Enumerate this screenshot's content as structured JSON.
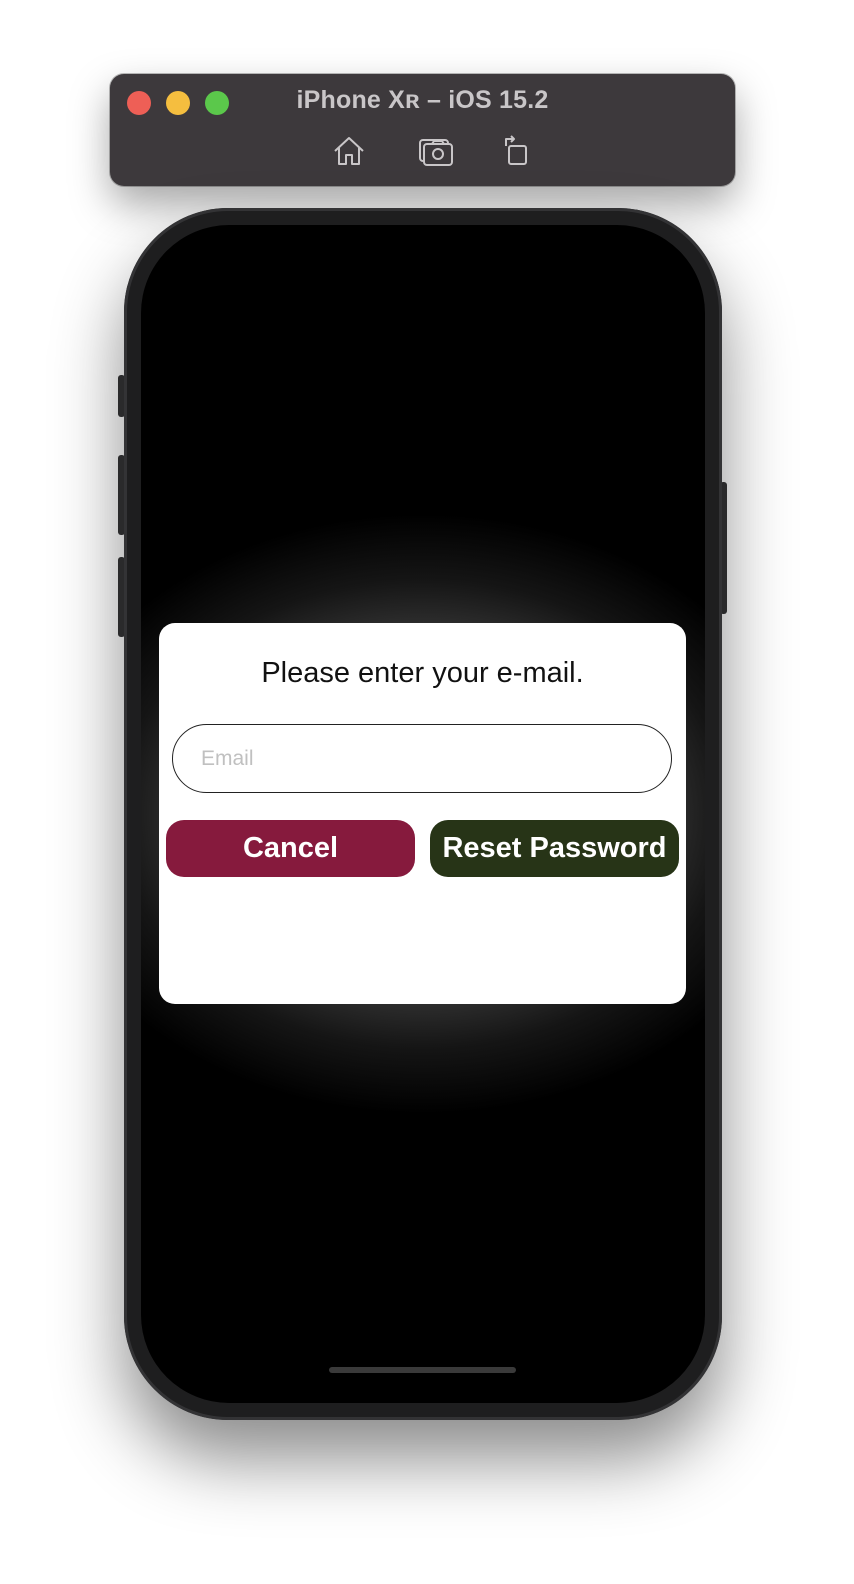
{
  "window": {
    "title": "iPhone Xʀ – iOS 15.2"
  },
  "toolbar": {
    "icons": [
      "home-icon",
      "screenshot-icon",
      "rotate-icon"
    ]
  },
  "dialog": {
    "message": "Please enter your e-mail.",
    "email": {
      "value": "",
      "placeholder": "Email"
    },
    "cancel_label": "Cancel",
    "reset_label": "Reset Password"
  },
  "colors": {
    "cancel": "#861a3d",
    "reset": "#273417",
    "toolbar": "#3d393c"
  }
}
